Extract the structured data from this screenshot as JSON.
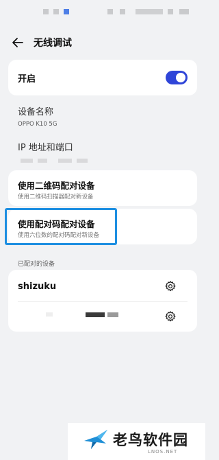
{
  "header": {
    "title": "无线调试"
  },
  "toggle": {
    "label": "开启",
    "enabled": true,
    "accent": "#2f45d8"
  },
  "device_name": {
    "title": "设备名称",
    "value": "OPPO K10 5G"
  },
  "ip": {
    "title": "IP 地址和端口"
  },
  "qr_pair": {
    "title": "使用二维码配对设备",
    "subtitle": "使用二维码扫描器配对新设备"
  },
  "code_pair": {
    "title": "使用配对码配对设备",
    "subtitle": "使用六位数的配对码配对新设备"
  },
  "paired": {
    "section_label": "已配对的设备",
    "devices": [
      {
        "name": "shizuku"
      }
    ]
  },
  "watermark": {
    "text": "老鸟软件园",
    "sub": "LNOS.NET"
  },
  "colors": {
    "highlight": "#1e8fe1",
    "background": "#f1f2f4"
  }
}
